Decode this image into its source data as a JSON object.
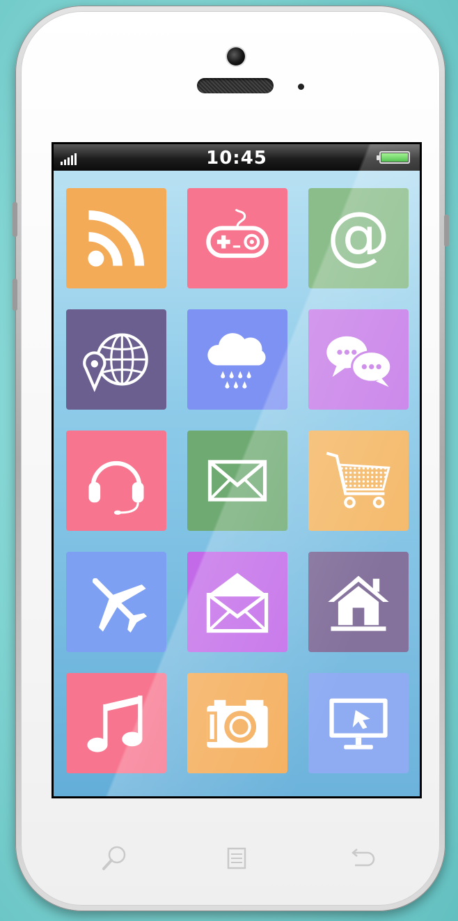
{
  "status_bar": {
    "time": "10:45",
    "signal_bars": 4,
    "battery_level": 1.0,
    "battery_color": "#3cc23a"
  },
  "home_screen": {
    "apps": [
      {
        "name": "rss",
        "icon": "rss-icon",
        "color": "#f4ab58"
      },
      {
        "name": "games",
        "icon": "gamepad-icon",
        "color": "#f7758e"
      },
      {
        "name": "email",
        "icon": "at-sign-icon",
        "color": "#8bbd8b"
      },
      {
        "name": "maps",
        "icon": "globe-pin-icon",
        "color": "#6b5f8f"
      },
      {
        "name": "weather",
        "icon": "rain-cloud-icon",
        "color": "#7d92f2"
      },
      {
        "name": "chat",
        "icon": "chat-bubbles-icon",
        "color": "#c77de8"
      },
      {
        "name": "music-support",
        "icon": "headset-icon",
        "color": "#f7758e"
      },
      {
        "name": "mail",
        "icon": "envelope-icon",
        "color": "#6eaa72"
      },
      {
        "name": "shop",
        "icon": "shopping-cart-icon",
        "color": "#f4b765"
      },
      {
        "name": "travel",
        "icon": "airplane-icon",
        "color": "#7da0f2"
      },
      {
        "name": "inbox",
        "icon": "open-envelope-icon",
        "color": "#c26ae8"
      },
      {
        "name": "home",
        "icon": "house-icon",
        "color": "#7c6896"
      },
      {
        "name": "music",
        "icon": "music-note-icon",
        "color": "#f7758e"
      },
      {
        "name": "camera",
        "icon": "camera-icon",
        "color": "#f4ac58"
      },
      {
        "name": "desktop",
        "icon": "monitor-cursor-icon",
        "color": "#88a7f2"
      }
    ]
  },
  "hardware_buttons": [
    {
      "name": "search",
      "icon": "search-icon"
    },
    {
      "name": "menu",
      "icon": "menu-icon"
    },
    {
      "name": "back",
      "icon": "back-arrow-icon"
    }
  ]
}
